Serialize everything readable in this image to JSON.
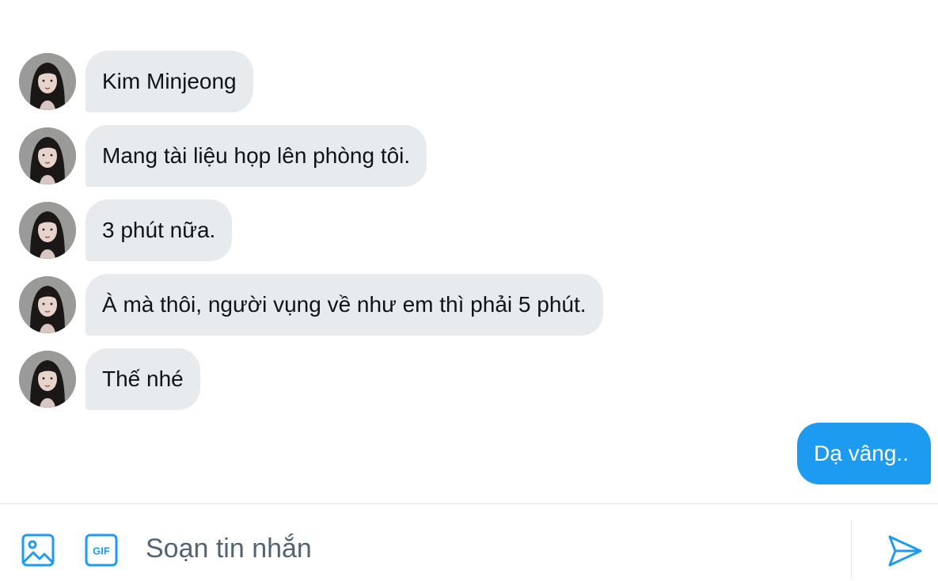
{
  "conversation": {
    "incoming": [
      {
        "avatar_icon": "profile-photo",
        "text": "Kim Minjeong"
      },
      {
        "avatar_icon": "profile-photo",
        "text": "Mang tài liệu họp lên phòng tôi."
      },
      {
        "avatar_icon": "profile-photo",
        "text": "3 phút nữa."
      },
      {
        "avatar_icon": "profile-photo",
        "text": "À mà thôi, người vụng về như em thì phải 5 phút."
      },
      {
        "avatar_icon": "profile-photo",
        "text": "Thế nhé"
      }
    ],
    "outgoing": [
      {
        "text": "Dạ vâng.."
      }
    ]
  },
  "composer": {
    "placeholder": "Soạn tin nhắn",
    "value": "",
    "image_icon": "image-icon",
    "gif_icon": "gif-icon",
    "gif_label": "GIF",
    "send_icon": "send-icon"
  },
  "colors": {
    "accent": "#1d9bf0",
    "incoming_bubble": "#e7ebee",
    "text": "#0f1419",
    "placeholder": "#536471"
  }
}
